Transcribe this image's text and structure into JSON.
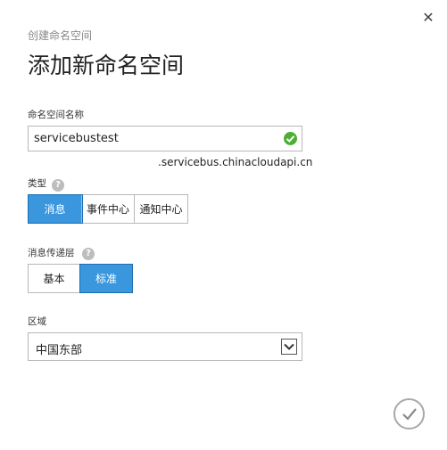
{
  "dialog": {
    "subtitle": "创建命名空间",
    "title": "添加新命名空间",
    "close_icon": "close-icon"
  },
  "namespace": {
    "label": "命名空间名称",
    "value": "servicebustest",
    "valid_icon": "check-circle-icon",
    "suffix": ".servicebus.chinacloudapi.cn"
  },
  "type": {
    "label": "类型",
    "help": "?",
    "options": [
      "消息",
      "事件中心",
      "通知中心"
    ],
    "selected": "消息"
  },
  "tier": {
    "label": "消息传递层",
    "help": "?",
    "options": [
      "基本",
      "标准"
    ],
    "selected": "标准"
  },
  "region": {
    "label": "区域",
    "value": "中国东部"
  },
  "colors": {
    "accent": "#3a96dd",
    "valid": "#4caf34"
  },
  "confirm_icon": "checkmark-circle-icon"
}
